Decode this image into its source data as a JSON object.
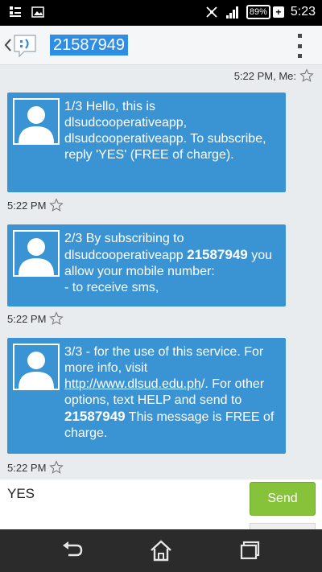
{
  "status_bar": {
    "time": "5:23",
    "battery": "89%",
    "icons": [
      "notification-icon",
      "image-icon",
      "silent-icon",
      "signal-icon",
      "battery-icon",
      "charging-icon"
    ]
  },
  "action_bar": {
    "title": "21587949",
    "icons": [
      "back-chevron-icon",
      "messaging-app-icon",
      "overflow-menu-icon"
    ]
  },
  "messages": {
    "top_meta": "5:22 PM, Me:",
    "items": [
      {
        "text": "1/3 Hello, this is dlsudcooperativeapp, dlsudcooperativeapp. To subscribe, reply 'YES' (FREE of charge).",
        "time": "5:22 PM"
      },
      {
        "text_before": "2/3 By subscribing to dlsudcooperativeapp ",
        "bold": "21587949",
        "text_after": " you allow your mobile number:",
        "line2": "- to receive sms,",
        "time": "5:22 PM"
      },
      {
        "text_before": "3/3 -  for the use of this service. For more info, visit ",
        "link": "http://www.dlsud.edu.ph",
        "text_mid": "/. For other options, text HELP and send to ",
        "bold": "21587949",
        "text_after": " This message is FREE of charge.",
        "time": "5:22 PM"
      }
    ]
  },
  "compose": {
    "text": "YES",
    "send_label": "Send"
  },
  "nav_bar": {
    "icons": [
      "back-icon",
      "home-icon",
      "recent-apps-icon"
    ]
  },
  "colors": {
    "bubble": "#3a94d4",
    "send": "#86c33a",
    "title_highlight": "#2f8de4"
  }
}
